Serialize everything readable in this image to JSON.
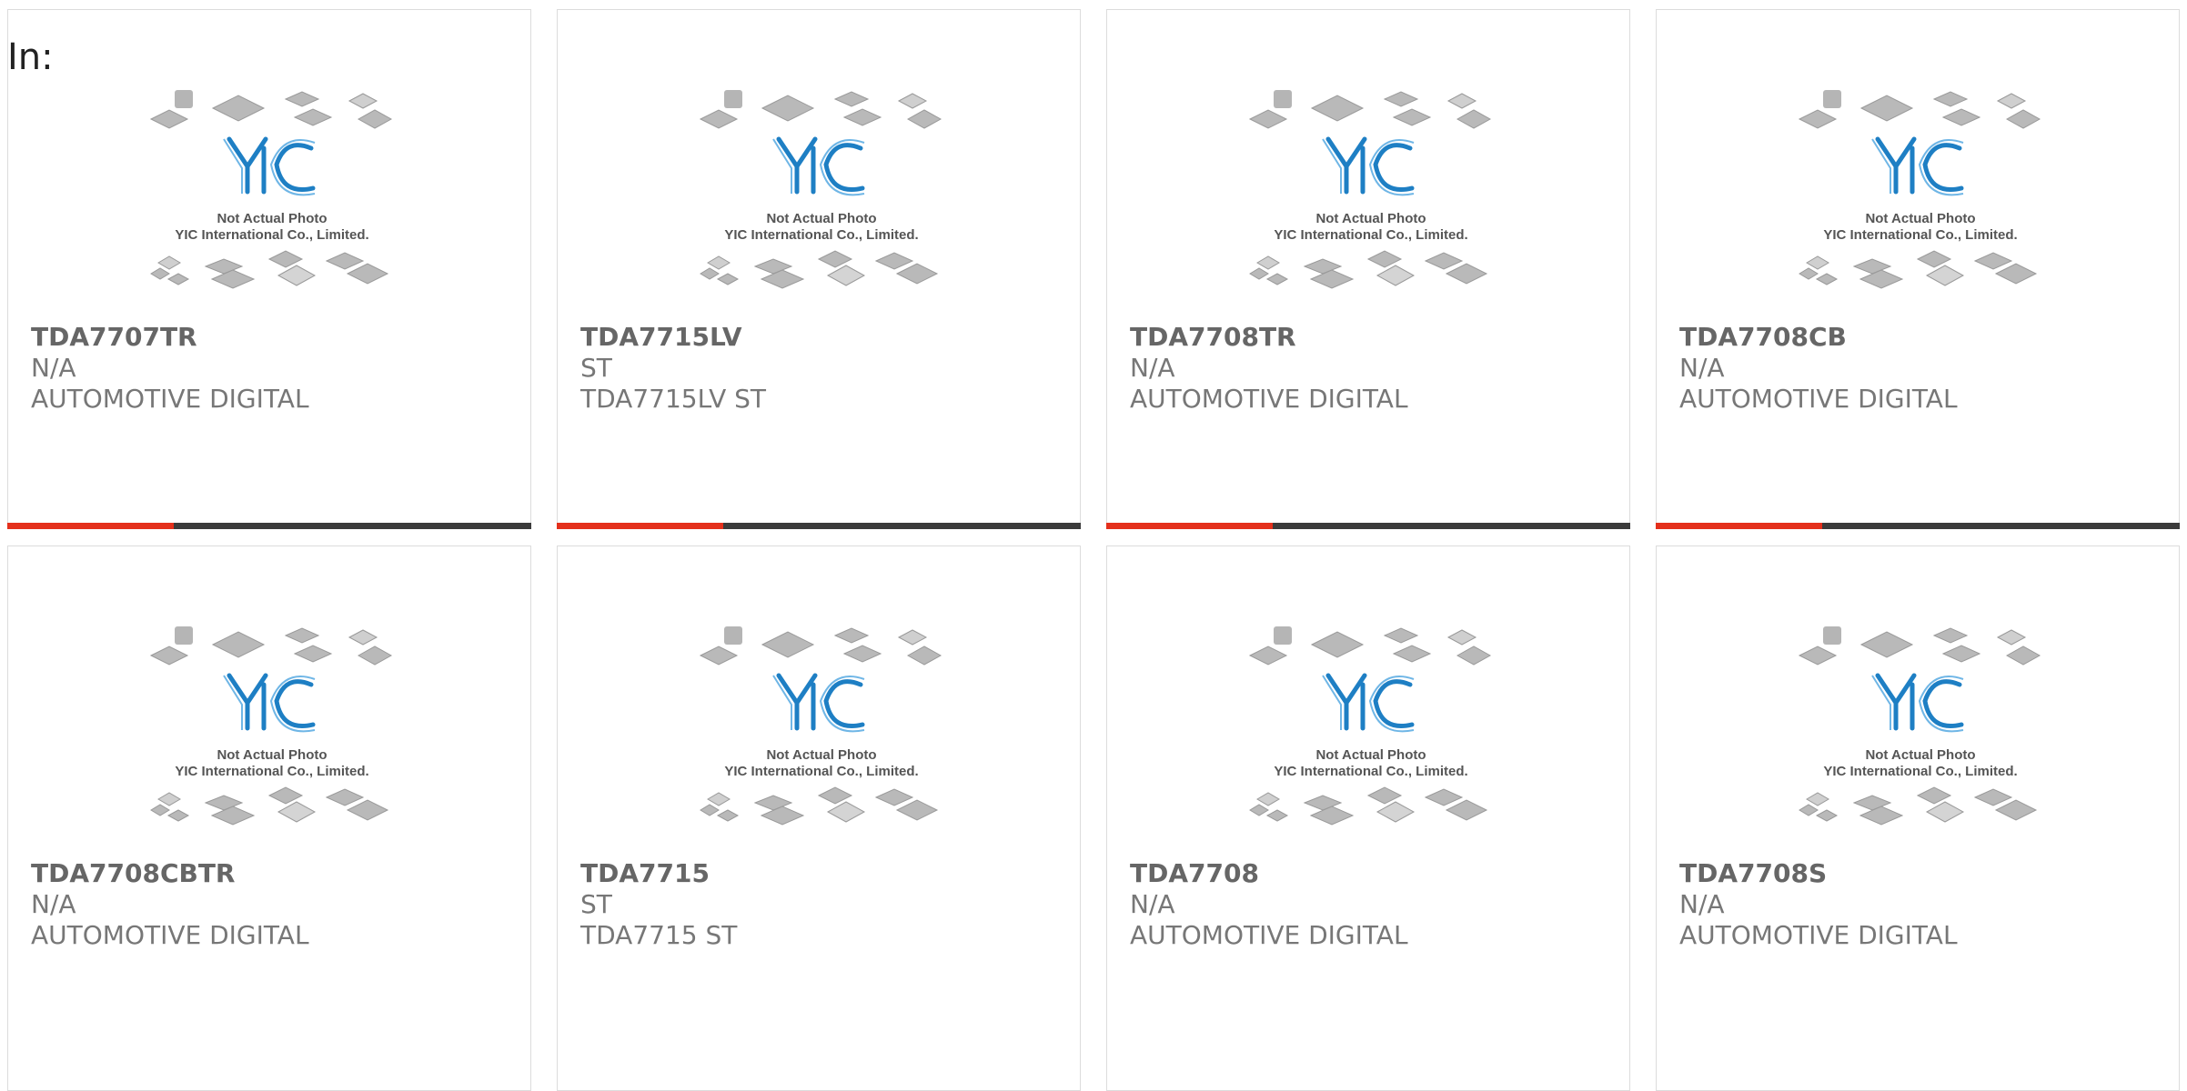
{
  "filter_label": "In:",
  "placeholder": {
    "line1": "Not Actual Photo",
    "line2": "YIC International Co., Limited.",
    "logo_text": "YIC"
  },
  "colors": {
    "accent_bar": "#e4301c",
    "dark_bar": "#3b3b3b",
    "logo_blue": "#1e7fc4"
  },
  "products": [
    {
      "part": "TDA7707TR",
      "mfr": "N/A",
      "desc": "AUTOMOTIVE DIGITAL"
    },
    {
      "part": "TDA7715LV",
      "mfr": "ST",
      "desc": "TDA7715LV ST"
    },
    {
      "part": "TDA7708TR",
      "mfr": "N/A",
      "desc": "AUTOMOTIVE DIGITAL"
    },
    {
      "part": "TDA7708CB",
      "mfr": "N/A",
      "desc": "AUTOMOTIVE DIGITAL"
    },
    {
      "part": "TDA7708CBTR",
      "mfr": "N/A",
      "desc": "AUTOMOTIVE DIGITAL"
    },
    {
      "part": "TDA7715",
      "mfr": "ST",
      "desc": "TDA7715 ST"
    },
    {
      "part": "TDA7708",
      "mfr": "N/A",
      "desc": "AUTOMOTIVE DIGITAL"
    },
    {
      "part": "TDA7708S",
      "mfr": "N/A",
      "desc": "AUTOMOTIVE DIGITAL"
    }
  ]
}
